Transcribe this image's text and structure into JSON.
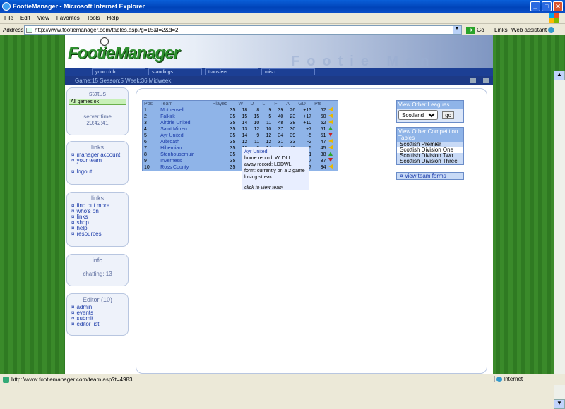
{
  "window": {
    "title": "FootieManager - Microsoft Internet Explorer",
    "buttons": [
      "_",
      "□",
      "✕"
    ]
  },
  "menu": [
    "File",
    "Edit",
    "View",
    "Favorites",
    "Tools",
    "Help"
  ],
  "address": {
    "label": "Address",
    "url": "http://www.footiemanager.com/tables.asp?g=15&l=2&d=2",
    "go": "Go",
    "links": "Links",
    "webassistant": "Web assistant"
  },
  "site": {
    "logo": "FootieManager",
    "banner_ghost": "Footie Man",
    "nav": [
      "your club",
      "standings",
      "transfers",
      "misc"
    ],
    "game_status": "Game:15  Season:5  Week:36 Midweek"
  },
  "sidebar": {
    "status": {
      "title": "status",
      "ok": "All games ok",
      "server_label": "server time",
      "server_time": "20:42:41"
    },
    "links1": {
      "title": "links",
      "items": [
        "manager account",
        "your team"
      ],
      "logout": "logout"
    },
    "links2": {
      "title": "links",
      "items": [
        "find out more",
        "who's on",
        "links",
        "shop",
        "help",
        "resources"
      ]
    },
    "info": {
      "title": "info",
      "chatting": "chatting: 13"
    },
    "editor": {
      "title": "Editor (10)",
      "items": [
        "admin",
        "events",
        "submit",
        "editor list"
      ]
    }
  },
  "table": {
    "headers": [
      "Pos",
      "Team",
      "Played",
      "W",
      "D",
      "L",
      "F",
      "A",
      "GD",
      "Pts"
    ],
    "rows": [
      {
        "pos": "1",
        "team": "Motherwell",
        "p": "35",
        "w": "18",
        "d": "8",
        "l": "9",
        "f": "39",
        "a": "26",
        "gd": "+13",
        "pts": "62",
        "trend": "same"
      },
      {
        "pos": "2",
        "team": "Falkirk",
        "p": "35",
        "w": "15",
        "d": "15",
        "l": "5",
        "f": "40",
        "a": "23",
        "gd": "+17",
        "pts": "60",
        "trend": "same"
      },
      {
        "pos": "3",
        "team": "Airdrie United",
        "p": "35",
        "w": "14",
        "d": "10",
        "l": "11",
        "f": "48",
        "a": "38",
        "gd": "+10",
        "pts": "52",
        "trend": "same"
      },
      {
        "pos": "4",
        "team": "Saint Mirren",
        "p": "35",
        "w": "13",
        "d": "12",
        "l": "10",
        "f": "37",
        "a": "30",
        "gd": "+7",
        "pts": "51",
        "trend": "up"
      },
      {
        "pos": "5",
        "team": "Ayr United",
        "p": "35",
        "w": "14",
        "d": "9",
        "l": "12",
        "f": "34",
        "a": "39",
        "gd": "-5",
        "pts": "51",
        "trend": "down"
      },
      {
        "pos": "6",
        "team": "Arbroath",
        "p": "35",
        "w": "12",
        "d": "11",
        "l": "12",
        "f": "31",
        "a": "33",
        "gd": "-2",
        "pts": "47",
        "trend": "same"
      },
      {
        "pos": "7",
        "team": "Hibernian",
        "p": "35",
        "w": "12",
        "d": "9",
        "l": "14",
        "f": "42",
        "a": "47",
        "gd": "-5",
        "pts": "45",
        "trend": "same"
      },
      {
        "pos": "8",
        "team": "Stenhousemuir",
        "p": "35",
        "w": "10",
        "d": "8",
        "l": "17",
        "f": "23",
        "a": "44",
        "gd": "-21",
        "pts": "38",
        "trend": "up"
      },
      {
        "pos": "9",
        "team": "Inverness",
        "p": "35",
        "w": "10",
        "d": "7",
        "l": "18",
        "f": "37",
        "a": "44",
        "gd": "-7",
        "pts": "37",
        "trend": "down"
      },
      {
        "pos": "10",
        "team": "Ross County",
        "p": "35",
        "w": "9",
        "d": "7",
        "l": "19",
        "f": "34",
        "a": "41",
        "gd": "-7",
        "pts": "34",
        "trend": "same"
      }
    ]
  },
  "tooltip": {
    "team": "Ayr United",
    "home": "home record: WLDLL",
    "away": "away record: LDDWL",
    "form": "form: currently on a 2 game",
    "form2": "losing streak",
    "click": "click to view team"
  },
  "leagues": {
    "title": "View Other Leagues",
    "selected": "Scotland",
    "go": "go"
  },
  "competitions": {
    "title": "View Other Competition Tables",
    "items": [
      "Scottish Premier",
      "Scottish Division One",
      "Scottish Division Two",
      "Scottish Division Three"
    ]
  },
  "forms_link": "view team forms",
  "status": {
    "url": "http://www.footiemanager.com/team.asp?t=4983",
    "zone": "Internet"
  }
}
